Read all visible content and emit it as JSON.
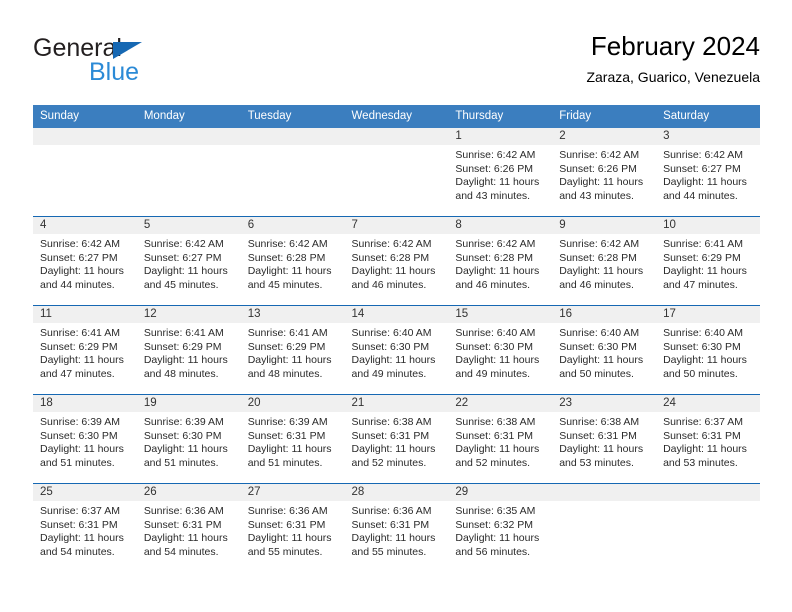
{
  "brand": {
    "name_part1": "General",
    "name_part2": "Blue",
    "triangle_color": "#1668b3",
    "blue_text_color": "#2b8ad6"
  },
  "header": {
    "title": "February 2024",
    "subtitle": "Zaraza, Guarico, Venezuela"
  },
  "theme": {
    "header_blue": "#3b7ebf",
    "row_divider_blue": "#1668b3",
    "daynum_band": "#f0f0f0"
  },
  "weekday_headers": [
    "Sunday",
    "Monday",
    "Tuesday",
    "Wednesday",
    "Thursday",
    "Friday",
    "Saturday"
  ],
  "weeks": [
    [
      {
        "day": "",
        "empty": true,
        "sunrise": "",
        "sunset": "",
        "daylight_line1": "",
        "daylight_line2": ""
      },
      {
        "day": "",
        "empty": true,
        "sunrise": "",
        "sunset": "",
        "daylight_line1": "",
        "daylight_line2": ""
      },
      {
        "day": "",
        "empty": true,
        "sunrise": "",
        "sunset": "",
        "daylight_line1": "",
        "daylight_line2": ""
      },
      {
        "day": "",
        "empty": true,
        "sunrise": "",
        "sunset": "",
        "daylight_line1": "",
        "daylight_line2": ""
      },
      {
        "day": "1",
        "empty": false,
        "sunrise": "Sunrise: 6:42 AM",
        "sunset": "Sunset: 6:26 PM",
        "daylight_line1": "Daylight: 11 hours",
        "daylight_line2": "and 43 minutes."
      },
      {
        "day": "2",
        "empty": false,
        "sunrise": "Sunrise: 6:42 AM",
        "sunset": "Sunset: 6:26 PM",
        "daylight_line1": "Daylight: 11 hours",
        "daylight_line2": "and 43 minutes."
      },
      {
        "day": "3",
        "empty": false,
        "sunrise": "Sunrise: 6:42 AM",
        "sunset": "Sunset: 6:27 PM",
        "daylight_line1": "Daylight: 11 hours",
        "daylight_line2": "and 44 minutes."
      }
    ],
    [
      {
        "day": "4",
        "empty": false,
        "sunrise": "Sunrise: 6:42 AM",
        "sunset": "Sunset: 6:27 PM",
        "daylight_line1": "Daylight: 11 hours",
        "daylight_line2": "and 44 minutes."
      },
      {
        "day": "5",
        "empty": false,
        "sunrise": "Sunrise: 6:42 AM",
        "sunset": "Sunset: 6:27 PM",
        "daylight_line1": "Daylight: 11 hours",
        "daylight_line2": "and 45 minutes."
      },
      {
        "day": "6",
        "empty": false,
        "sunrise": "Sunrise: 6:42 AM",
        "sunset": "Sunset: 6:28 PM",
        "daylight_line1": "Daylight: 11 hours",
        "daylight_line2": "and 45 minutes."
      },
      {
        "day": "7",
        "empty": false,
        "sunrise": "Sunrise: 6:42 AM",
        "sunset": "Sunset: 6:28 PM",
        "daylight_line1": "Daylight: 11 hours",
        "daylight_line2": "and 46 minutes."
      },
      {
        "day": "8",
        "empty": false,
        "sunrise": "Sunrise: 6:42 AM",
        "sunset": "Sunset: 6:28 PM",
        "daylight_line1": "Daylight: 11 hours",
        "daylight_line2": "and 46 minutes."
      },
      {
        "day": "9",
        "empty": false,
        "sunrise": "Sunrise: 6:42 AM",
        "sunset": "Sunset: 6:28 PM",
        "daylight_line1": "Daylight: 11 hours",
        "daylight_line2": "and 46 minutes."
      },
      {
        "day": "10",
        "empty": false,
        "sunrise": "Sunrise: 6:41 AM",
        "sunset": "Sunset: 6:29 PM",
        "daylight_line1": "Daylight: 11 hours",
        "daylight_line2": "and 47 minutes."
      }
    ],
    [
      {
        "day": "11",
        "empty": false,
        "sunrise": "Sunrise: 6:41 AM",
        "sunset": "Sunset: 6:29 PM",
        "daylight_line1": "Daylight: 11 hours",
        "daylight_line2": "and 47 minutes."
      },
      {
        "day": "12",
        "empty": false,
        "sunrise": "Sunrise: 6:41 AM",
        "sunset": "Sunset: 6:29 PM",
        "daylight_line1": "Daylight: 11 hours",
        "daylight_line2": "and 48 minutes."
      },
      {
        "day": "13",
        "empty": false,
        "sunrise": "Sunrise: 6:41 AM",
        "sunset": "Sunset: 6:29 PM",
        "daylight_line1": "Daylight: 11 hours",
        "daylight_line2": "and 48 minutes."
      },
      {
        "day": "14",
        "empty": false,
        "sunrise": "Sunrise: 6:40 AM",
        "sunset": "Sunset: 6:30 PM",
        "daylight_line1": "Daylight: 11 hours",
        "daylight_line2": "and 49 minutes."
      },
      {
        "day": "15",
        "empty": false,
        "sunrise": "Sunrise: 6:40 AM",
        "sunset": "Sunset: 6:30 PM",
        "daylight_line1": "Daylight: 11 hours",
        "daylight_line2": "and 49 minutes."
      },
      {
        "day": "16",
        "empty": false,
        "sunrise": "Sunrise: 6:40 AM",
        "sunset": "Sunset: 6:30 PM",
        "daylight_line1": "Daylight: 11 hours",
        "daylight_line2": "and 50 minutes."
      },
      {
        "day": "17",
        "empty": false,
        "sunrise": "Sunrise: 6:40 AM",
        "sunset": "Sunset: 6:30 PM",
        "daylight_line1": "Daylight: 11 hours",
        "daylight_line2": "and 50 minutes."
      }
    ],
    [
      {
        "day": "18",
        "empty": false,
        "sunrise": "Sunrise: 6:39 AM",
        "sunset": "Sunset: 6:30 PM",
        "daylight_line1": "Daylight: 11 hours",
        "daylight_line2": "and 51 minutes."
      },
      {
        "day": "19",
        "empty": false,
        "sunrise": "Sunrise: 6:39 AM",
        "sunset": "Sunset: 6:30 PM",
        "daylight_line1": "Daylight: 11 hours",
        "daylight_line2": "and 51 minutes."
      },
      {
        "day": "20",
        "empty": false,
        "sunrise": "Sunrise: 6:39 AM",
        "sunset": "Sunset: 6:31 PM",
        "daylight_line1": "Daylight: 11 hours",
        "daylight_line2": "and 51 minutes."
      },
      {
        "day": "21",
        "empty": false,
        "sunrise": "Sunrise: 6:38 AM",
        "sunset": "Sunset: 6:31 PM",
        "daylight_line1": "Daylight: 11 hours",
        "daylight_line2": "and 52 minutes."
      },
      {
        "day": "22",
        "empty": false,
        "sunrise": "Sunrise: 6:38 AM",
        "sunset": "Sunset: 6:31 PM",
        "daylight_line1": "Daylight: 11 hours",
        "daylight_line2": "and 52 minutes."
      },
      {
        "day": "23",
        "empty": false,
        "sunrise": "Sunrise: 6:38 AM",
        "sunset": "Sunset: 6:31 PM",
        "daylight_line1": "Daylight: 11 hours",
        "daylight_line2": "and 53 minutes."
      },
      {
        "day": "24",
        "empty": false,
        "sunrise": "Sunrise: 6:37 AM",
        "sunset": "Sunset: 6:31 PM",
        "daylight_line1": "Daylight: 11 hours",
        "daylight_line2": "and 53 minutes."
      }
    ],
    [
      {
        "day": "25",
        "empty": false,
        "sunrise": "Sunrise: 6:37 AM",
        "sunset": "Sunset: 6:31 PM",
        "daylight_line1": "Daylight: 11 hours",
        "daylight_line2": "and 54 minutes."
      },
      {
        "day": "26",
        "empty": false,
        "sunrise": "Sunrise: 6:36 AM",
        "sunset": "Sunset: 6:31 PM",
        "daylight_line1": "Daylight: 11 hours",
        "daylight_line2": "and 54 minutes."
      },
      {
        "day": "27",
        "empty": false,
        "sunrise": "Sunrise: 6:36 AM",
        "sunset": "Sunset: 6:31 PM",
        "daylight_line1": "Daylight: 11 hours",
        "daylight_line2": "and 55 minutes."
      },
      {
        "day": "28",
        "empty": false,
        "sunrise": "Sunrise: 6:36 AM",
        "sunset": "Sunset: 6:31 PM",
        "daylight_line1": "Daylight: 11 hours",
        "daylight_line2": "and 55 minutes."
      },
      {
        "day": "29",
        "empty": false,
        "sunrise": "Sunrise: 6:35 AM",
        "sunset": "Sunset: 6:32 PM",
        "daylight_line1": "Daylight: 11 hours",
        "daylight_line2": "and 56 minutes."
      },
      {
        "day": "",
        "empty": true,
        "sunrise": "",
        "sunset": "",
        "daylight_line1": "",
        "daylight_line2": ""
      },
      {
        "day": "",
        "empty": true,
        "sunrise": "",
        "sunset": "",
        "daylight_line1": "",
        "daylight_line2": ""
      }
    ]
  ]
}
